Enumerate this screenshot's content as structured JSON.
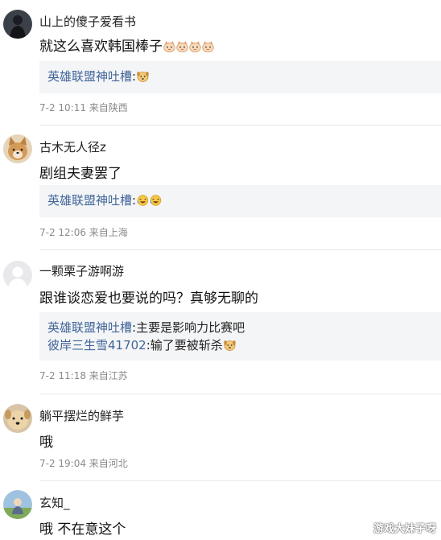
{
  "comments": [
    {
      "username": "山上的傻子爱看书",
      "content": "就这么喜欢韩国棒子",
      "content_emojis": [
        "cat-face-emoji",
        "cat-face-emoji",
        "cat-face-emoji",
        "cat-face-emoji"
      ],
      "replies": [
        {
          "user": "英雄联盟神吐槽",
          "text": "",
          "emojis": [
            "dog-face-emoji"
          ]
        }
      ],
      "meta": "7-2 10:11 来自陕西"
    },
    {
      "username": "古木无人径z",
      "content": "剧组夫妻罢了",
      "content_emojis": [],
      "replies": [
        {
          "user": "英雄联盟神吐槽",
          "text": "",
          "emojis": [
            "laughing-face-emoji",
            "laughing-face-emoji"
          ]
        }
      ],
      "meta": "7-2 12:06 来自上海"
    },
    {
      "username": "一颗栗子游啊游",
      "content": "跟谁谈恋爱也要说的吗？真够无聊的",
      "content_emojis": [],
      "replies": [
        {
          "user": "英雄联盟神吐槽",
          "text": "主要是影响力比赛吧",
          "emojis": []
        },
        {
          "user": "彼岸三生雪41702",
          "text": "输了要被斩杀",
          "emojis": [
            "dog-face-emoji"
          ]
        }
      ],
      "meta": "7-2 11:18 来自江苏"
    },
    {
      "username": "躺平摆烂的鲜芋",
      "content": "哦",
      "content_emojis": [],
      "replies": [],
      "meta": "7-2 19:04 来自河北"
    },
    {
      "username": "玄知_",
      "content": "哦 不在意这个",
      "content_emojis": [],
      "replies": [],
      "meta": ""
    }
  ],
  "watermark": "游戏大妹子呀",
  "colors": {
    "link": "#406599",
    "reply_bg": "#f4f5f7",
    "meta": "#8a8a8a",
    "divider": "#e6e6e6"
  }
}
